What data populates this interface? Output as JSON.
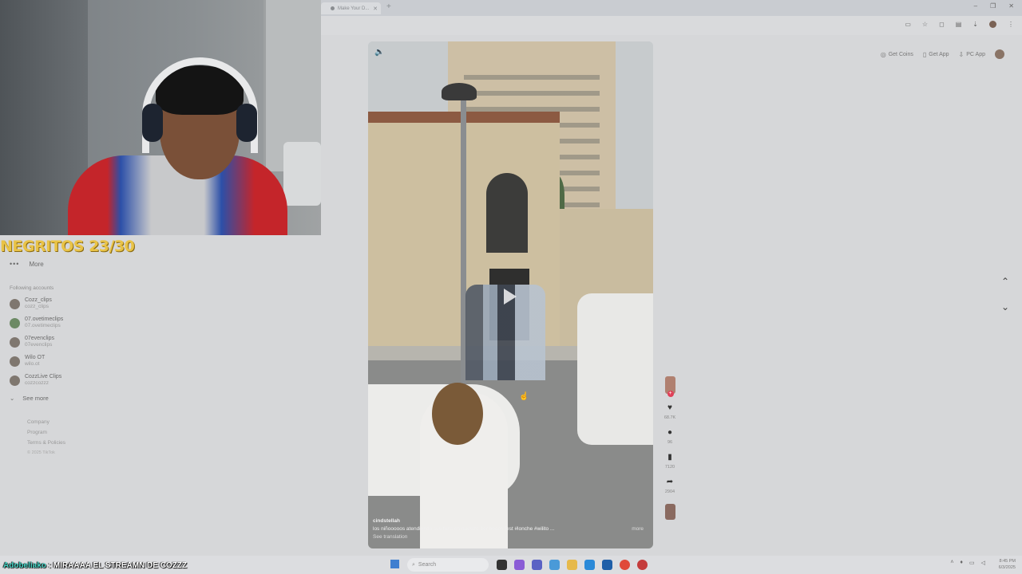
{
  "browser": {
    "tab_title": "Make Your D...",
    "new_tab_symbol": "+",
    "window_controls": [
      "–",
      "❐",
      "✕"
    ]
  },
  "topnav": {
    "get_coins": "Get Coins",
    "get_app": "Get App",
    "pc_app": "PC App"
  },
  "stream": {
    "counter": "NEGRITOS 23/30",
    "chat_user": "Adobeliako",
    "chat_sep": " : ",
    "chat_message": "MIRAAAA EL STREAMN DE COZZZ"
  },
  "sidebar": {
    "more_label": "More",
    "following_title": "Following accounts",
    "accounts": [
      {
        "name": "Cozz_clips",
        "handle": "cozz_clips"
      },
      {
        "name": "07.ovetimeclips",
        "handle": "07.ovetimeclips"
      },
      {
        "name": "07evenclips",
        "handle": "07evenclips"
      },
      {
        "name": "Wilo OT",
        "handle": "wilo.ot"
      },
      {
        "name": "CozzLive Clips",
        "handle": "cozzcozzz"
      }
    ],
    "see_more": "See more",
    "footer": {
      "company": "Company",
      "program": "Program",
      "terms": "Terms & Policies",
      "copyright": "© 2025 TikTok"
    }
  },
  "video": {
    "username": "cindstellah",
    "description": "los niñooooos atendiendo sus fans en nuestro 1er beach fest",
    "hashtags": "#lonche  #wilito ...",
    "more_label": "more",
    "see_translation": "See translation",
    "likes": "68.7K",
    "comments": "96",
    "saves": "7120",
    "shares": "2904"
  },
  "taskbar": {
    "search_placeholder": "Search",
    "time": "8:45 PM",
    "date": "6/3/2025"
  },
  "colors": {
    "counter": "#e9c347",
    "chat_user": "#46d4c5",
    "follow_plus": "#e04058"
  }
}
